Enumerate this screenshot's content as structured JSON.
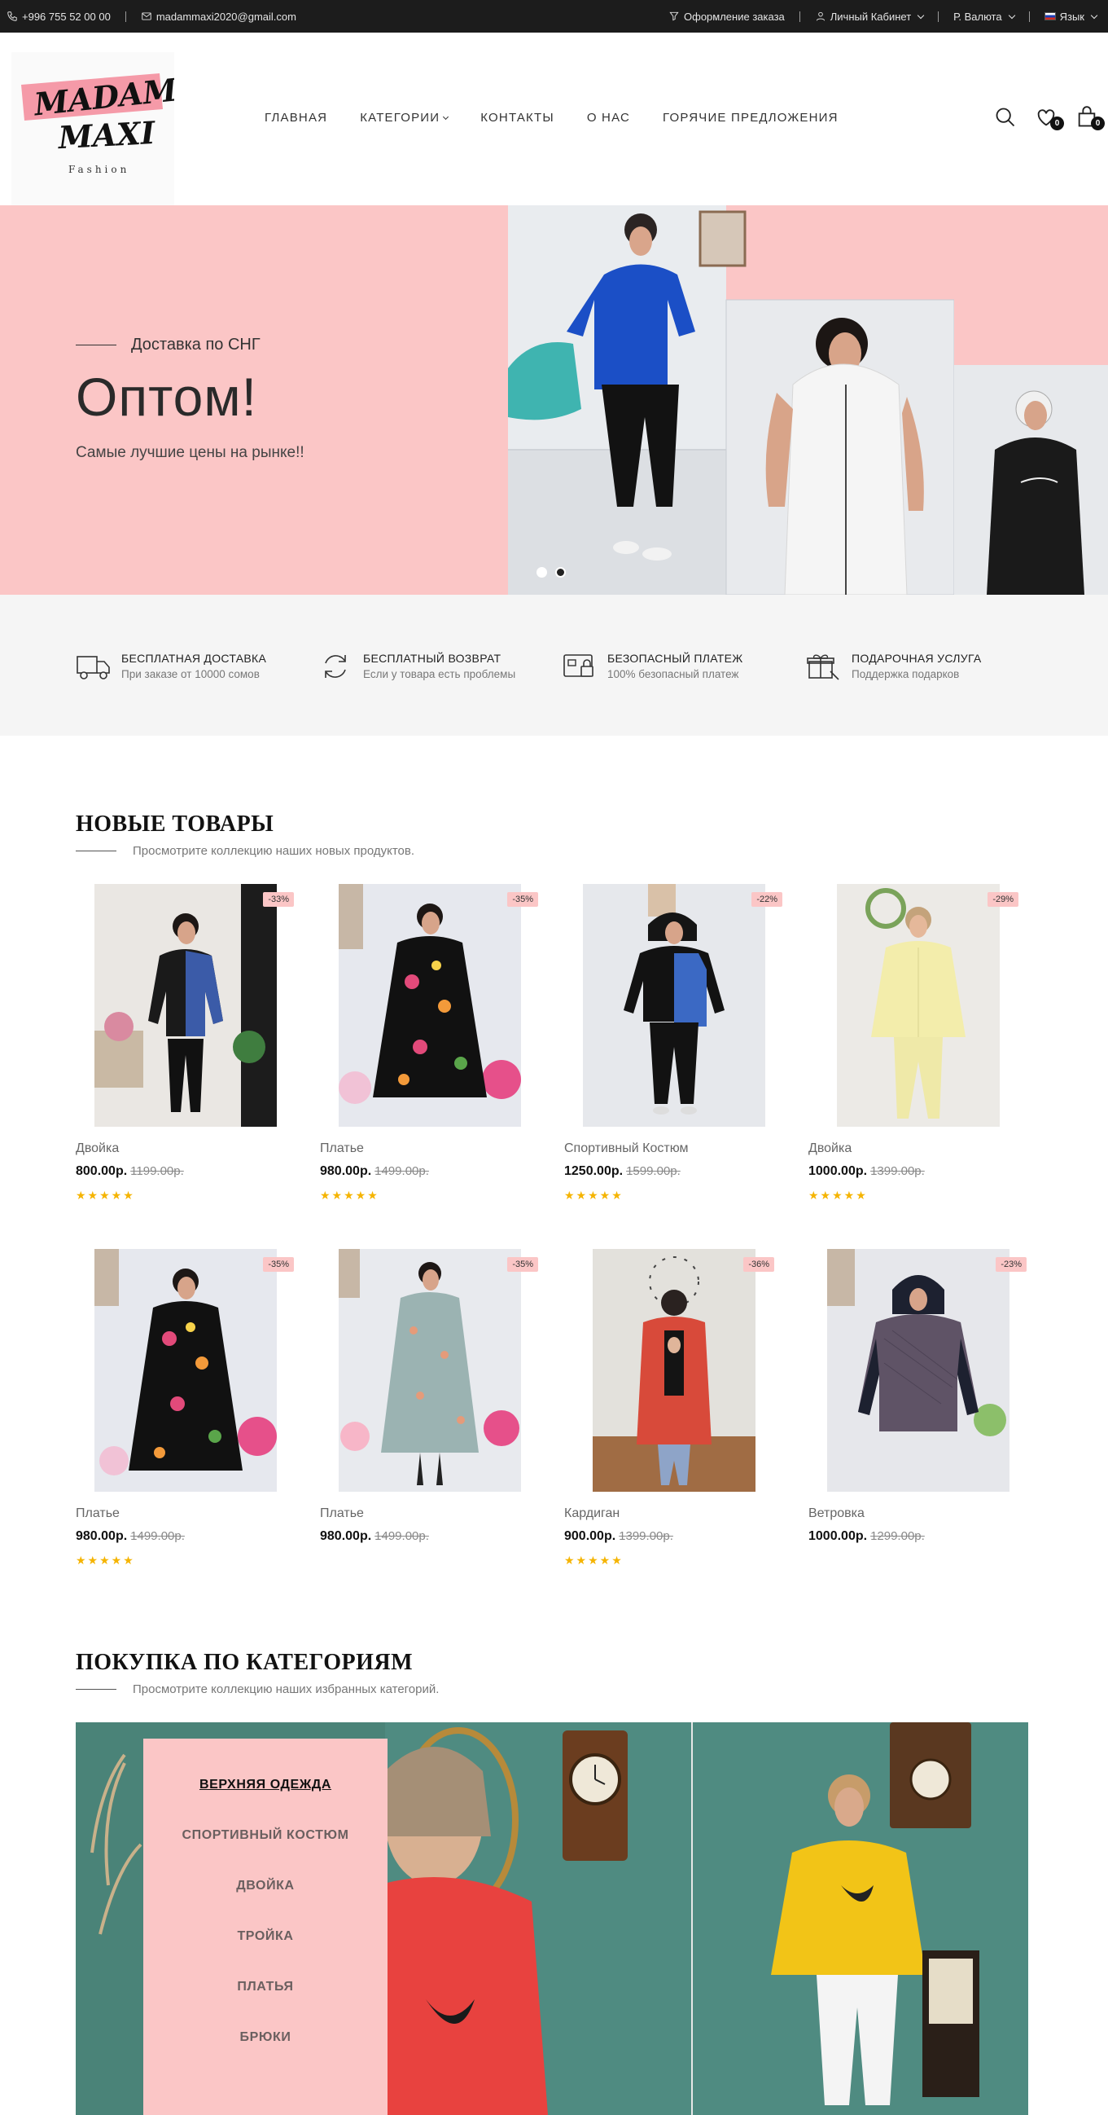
{
  "topbar": {
    "phone": "+996 755 52 00 00",
    "email": "madammaxi2020@gmail.com",
    "order_label": "Оформление заказа",
    "account_label": "Личный Кабинет",
    "currency_label": "Р. Валюта",
    "language_label": "Язык"
  },
  "logo": {
    "line1": "MADAM",
    "line2": "MAXI",
    "tagline": "Fashion"
  },
  "nav": {
    "home": "ГЛАВНАЯ",
    "categories": "КАТЕГОРИИ",
    "contacts": "КОНТАКТЫ",
    "about": "О НАС",
    "hot": "ГОРЯЧИЕ ПРЕДЛОЖЕНИЯ"
  },
  "header_icons": {
    "wishlist_count": "0",
    "cart_count": "0"
  },
  "hero": {
    "subtitle": "Доставка по СНГ",
    "title": "Оптом!",
    "description": "Самые лучшие цены на рынке!!",
    "slides": 2,
    "active_slide": 2
  },
  "features": [
    {
      "icon": "truck-icon",
      "title": "БЕСПЛАТНАЯ ДОСТАВКА",
      "subtitle": "При заказе от 10000 сомов"
    },
    {
      "icon": "refresh-icon",
      "title": "БЕСПЛАТНЫЙ ВОЗВРАТ",
      "subtitle": "Если у товара есть проблемы"
    },
    {
      "icon": "secure-payment-icon",
      "title": "БЕЗОПАСНЫЙ ПЛАТЕЖ",
      "subtitle": "100% безопасный платеж"
    },
    {
      "icon": "gift-icon",
      "title": "ПОДАРОЧНАЯ УСЛУГА",
      "subtitle": "Поддержка подарков"
    }
  ],
  "new_products": {
    "title": "НОВЫЕ ТОВАРЫ",
    "subtitle": "Просмотрите коллекцию наших новых продуктов.",
    "items": [
      {
        "name": "Двойка",
        "price": "800.00р.",
        "old_price": "1199.00р.",
        "discount": "-33%",
        "stars": "★★★★★"
      },
      {
        "name": "Платье",
        "price": "980.00р.",
        "old_price": "1499.00р.",
        "discount": "-35%",
        "stars": "★★★★★"
      },
      {
        "name": "Спортивный Костюм",
        "price": "1250.00р.",
        "old_price": "1599.00р.",
        "discount": "-22%",
        "stars": "★★★★★"
      },
      {
        "name": "Двойка",
        "price": "1000.00р.",
        "old_price": "1399.00р.",
        "discount": "-29%",
        "stars": "★★★★★"
      },
      {
        "name": "Платье",
        "price": "980.00р.",
        "old_price": "1499.00р.",
        "discount": "-35%",
        "stars": "★★★★★"
      },
      {
        "name": "Платье",
        "price": "980.00р.",
        "old_price": "1499.00р.",
        "discount": "-35%",
        "stars": ""
      },
      {
        "name": "Кардиган",
        "price": "900.00р.",
        "old_price": "1399.00р.",
        "discount": "-36%",
        "stars": "★★★★★"
      },
      {
        "name": "Ветровка",
        "price": "1000.00р.",
        "old_price": "1299.00р.",
        "discount": "-23%",
        "stars": ""
      }
    ]
  },
  "categories": {
    "title": "ПОКУПКА ПО КАТЕГОРИЯМ",
    "subtitle": "Просмотрите коллекцию наших избранных категорий.",
    "items": [
      "ВЕРХНЯЯ ОДЕЖДА",
      "СПОРТИВНЫЙ КОСТЮМ",
      "ДВОЙКА",
      "ТРОЙКА",
      "ПЛАТЬЯ",
      "БРЮКИ"
    ],
    "active": "ВЕРХНЯЯ ОДЕЖДА"
  },
  "colors": {
    "pink": "#fbc6c6",
    "dark": "#1c1c1c",
    "star": "#f5b400",
    "teal": "#4e8a80"
  }
}
